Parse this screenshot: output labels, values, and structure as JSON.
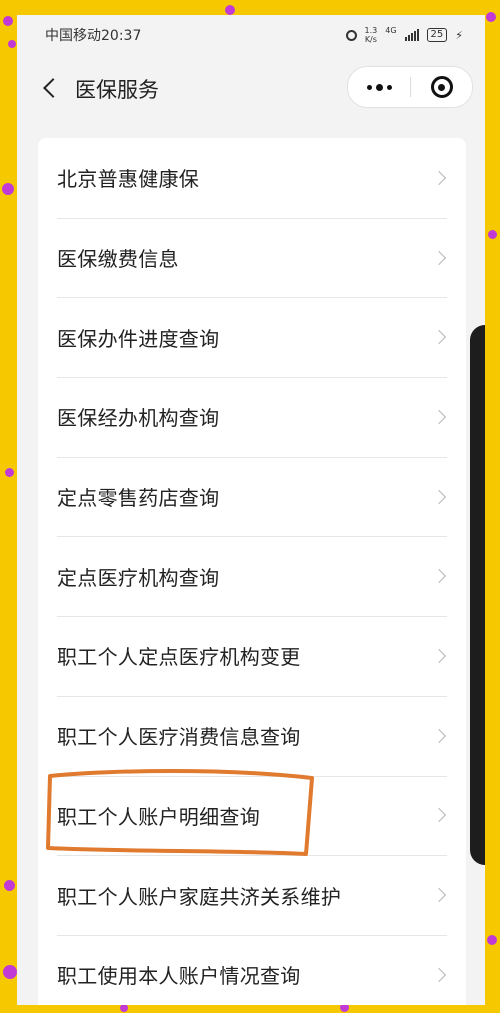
{
  "status_bar": {
    "carrier_time": "中国移动20:37",
    "net_speed_value": "1.3",
    "net_speed_unit": "K/s",
    "network": "4G",
    "battery": "25"
  },
  "nav": {
    "title": "医保服务",
    "back_icon": "chevron-left-icon",
    "more_icon": "more-dots-icon",
    "close_icon": "record-circle-icon"
  },
  "menu_items": [
    "北京普惠健康保",
    "医保缴费信息",
    "医保办件进度查询",
    "医保经办机构查询",
    "定点零售药店查询",
    "定点医疗机构查询",
    "职工个人定点医疗机构变更",
    "职工个人医疗消费信息查询",
    "职工个人账户明细查询",
    "职工个人账户家庭共济关系维护",
    "职工使用本人账户情况查询"
  ],
  "highlighted_item": "职工个人账户明细查询",
  "colors": {
    "frame": "#f6c800",
    "dots": "#c23ad6",
    "annotation": "#e07a2e",
    "background": "#f3f3f3"
  }
}
